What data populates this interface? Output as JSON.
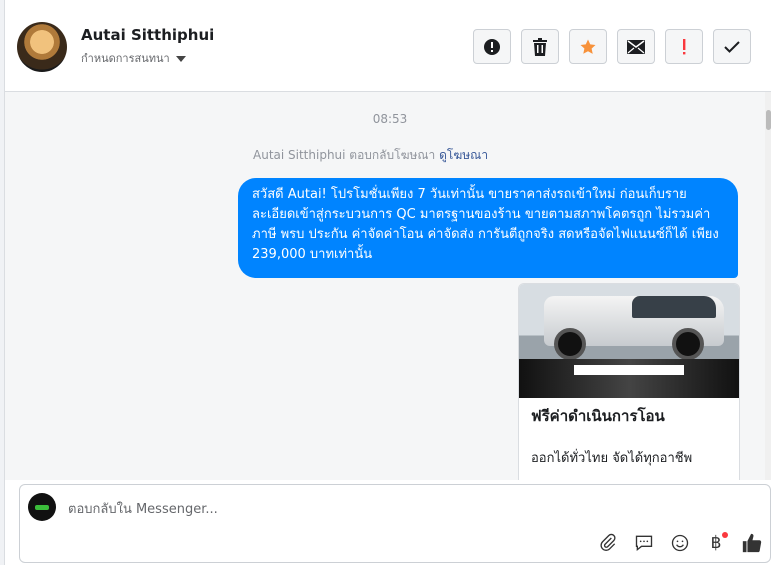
{
  "header": {
    "name": "Autai Sitthiphui",
    "subtitle": "กำหนดการสนทนา",
    "buttons": [
      {
        "name": "spam-button",
        "icon": "alert-circle-icon"
      },
      {
        "name": "delete-button",
        "icon": "trash-icon"
      },
      {
        "name": "star-button",
        "icon": "star-icon"
      },
      {
        "name": "mark-unread-button",
        "icon": "mail-icon"
      },
      {
        "name": "flag-button",
        "icon": "exclamation-icon"
      },
      {
        "name": "done-button",
        "icon": "check-icon"
      }
    ]
  },
  "thread": {
    "time": "08:53",
    "reply_note": "Autai Sitthiphui ตอบกลับโฆษณา",
    "reply_link": "ดูโฆษณา",
    "message": "สวัสดี Autai! โปรโมชั่นเพียง 7 วันเท่านั้น ขายราคาส่งรถเข้าใหม่ ก่อนเก็บรายละเอียดเข้าสู่กระบวนการ QC มาตรฐานของร้าน ขายตามสภาพโคตรถูก ไม่รวมค่า ภาษี พรบ ประกัน ค่าจัดค่าโอน ค่าจัดส่ง การันตีถูกจริง สดหรือจัดไฟแนนซ์ก็ได้  เพียง 239,000 บาทเท่านั้น",
    "card": {
      "title": "ฟรีค่าดำเนินการโอน",
      "description": "ออกได้ทั่วไทย จัดได้ทุกอาชีพ"
    }
  },
  "composer": {
    "placeholder": "ตอบกลับใน Messenger...",
    "icons": [
      "paperclip-icon",
      "saved-reply-icon",
      "emoji-icon",
      "baht-payment-icon",
      "thumbs-up-icon"
    ]
  },
  "colors": {
    "bubble": "#0084ff",
    "star": "#f7923b",
    "flag": "#fa383e"
  }
}
